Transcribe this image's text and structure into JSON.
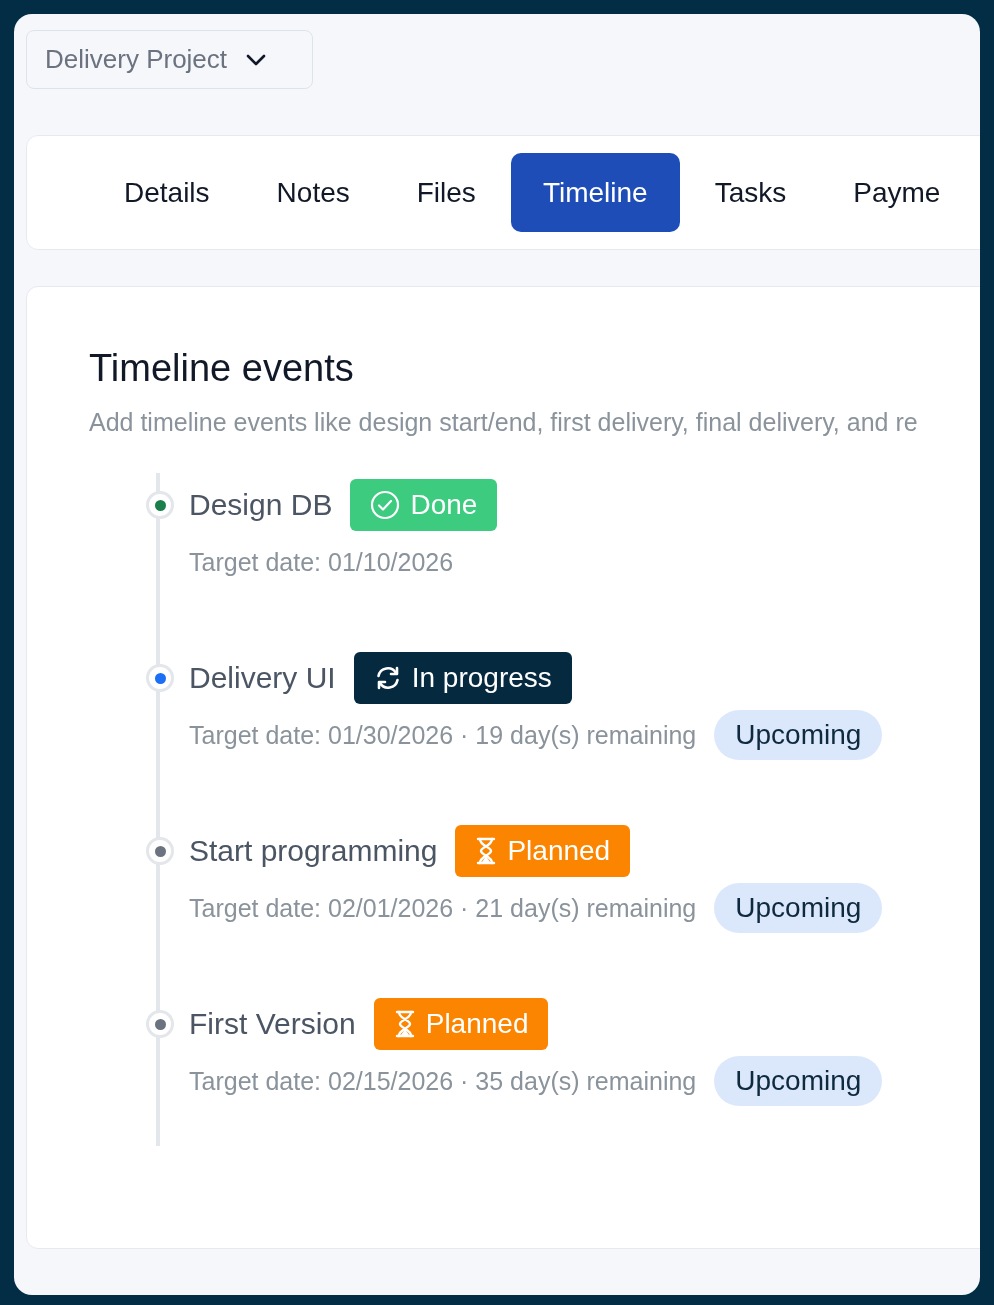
{
  "project_select": {
    "value": "Delivery Project"
  },
  "tabs": [
    {
      "label": "Details",
      "selected": false
    },
    {
      "label": "Notes",
      "selected": false
    },
    {
      "label": "Files",
      "selected": false
    },
    {
      "label": "Timeline",
      "selected": true
    },
    {
      "label": "Tasks",
      "selected": false
    },
    {
      "label": "Payme",
      "selected": false
    }
  ],
  "timeline": {
    "title": "Timeline events",
    "description": "Add timeline events like design start/end, first delivery, final delivery, and re",
    "events": [
      {
        "title": "Design DB",
        "color": "#1a7f4b",
        "status": {
          "kind": "done",
          "label": "Done"
        },
        "detail": "Target date: 01/10/2026"
      },
      {
        "title": "Delivery UI",
        "color": "#1a6ff5",
        "status": {
          "kind": "in_progress",
          "label": "In progress"
        },
        "detail": "Target date: 01/30/2026 · 19 day(s) remaining",
        "due": "Upcoming"
      },
      {
        "title": "Start programming",
        "color": "#6b7280",
        "status": {
          "kind": "planned",
          "label": "Planned"
        },
        "detail": "Target date: 02/01/2026 · 21 day(s) remaining",
        "due": "Upcoming"
      },
      {
        "title": "First Version",
        "color": "#6b7280",
        "status": {
          "kind": "planned",
          "label": "Planned"
        },
        "detail": "Target date: 02/15/2026 · 35 day(s) remaining",
        "due": "Upcoming"
      }
    ]
  }
}
